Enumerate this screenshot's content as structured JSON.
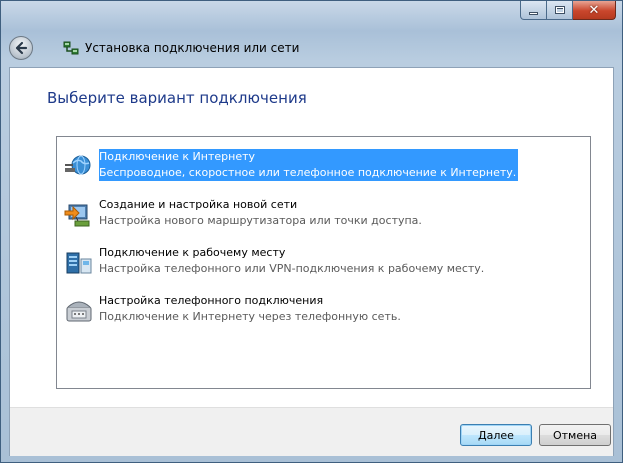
{
  "window": {
    "title": "Установка подключения или сети",
    "colors": {
      "heading": "#1e3a8a",
      "selection": "#3399ff",
      "close_button": "#c9462c"
    }
  },
  "header": {
    "back_icon": "back-arrow-icon",
    "wizard_icon": "network-icon"
  },
  "main": {
    "heading": "Выберите вариант подключения",
    "options": [
      {
        "title": "Подключение к Интернету",
        "description": "Беспроводное, скоростное или телефонное подключение к Интернету.",
        "icon": "globe-icon",
        "selected": true
      },
      {
        "title": "Создание и настройка новой сети",
        "description": "Настройка нового маршрутизатора или точки доступа.",
        "icon": "router-icon",
        "selected": false
      },
      {
        "title": "Подключение к рабочему месту",
        "description": "Настройка телефонного или VPN-подключения к рабочему месту.",
        "icon": "workplace-icon",
        "selected": false
      },
      {
        "title": "Настройка телефонного подключения",
        "description": "Подключение к Интернету через телефонную сеть.",
        "icon": "phone-icon",
        "selected": false
      }
    ]
  },
  "footer": {
    "next_label": "Далее",
    "cancel_label": "Отмена"
  }
}
